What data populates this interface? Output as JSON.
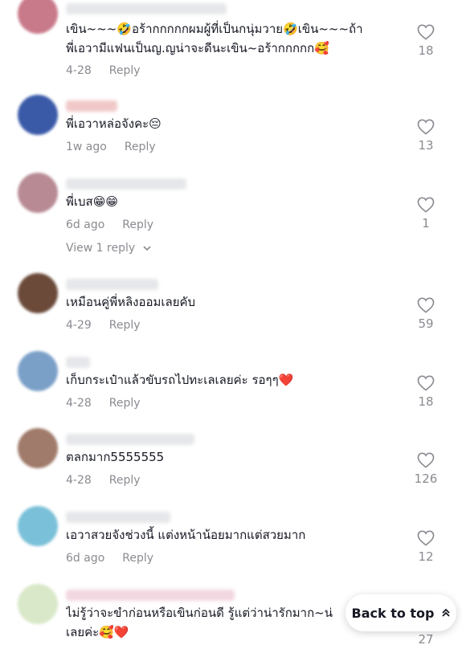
{
  "comments": [
    {
      "text_line1": "เขิน~~~🤣อร้ากกกกกผมผู้ที่เป็นกนุ่มวาย🤣เขิน~~~ถ้า",
      "text_line2": "พี่เอวามีแฟนเป็นญ.ญน่าจะดีนะเขิน~อร้ากกกกก🥰",
      "date": "4-28",
      "reply": "Reply",
      "likes": "18",
      "avatar_color": "#c97a8a"
    },
    {
      "text_line1": "พี่เอวาหล่อจังคะ😔",
      "date": "1w ago",
      "reply": "Reply",
      "likes": "13",
      "avatar_color": "#3a5aa8"
    },
    {
      "text_line1": "พี่เบส😁😁",
      "date": "6d ago",
      "reply": "Reply",
      "likes": "1",
      "view_replies": "View 1 reply",
      "avatar_color": "#b88a94"
    },
    {
      "text_line1": "เหมือนคู่พี่หลิงออมเลยคับ",
      "date": "4-29",
      "reply": "Reply",
      "likes": "59",
      "avatar_color": "#6b4a3a"
    },
    {
      "text_line1": "เก็บกระเป๋าแล้วขับรถไปทะเลเลยค่ะ รอๆๆ❤️",
      "date": "4-28",
      "reply": "Reply",
      "likes": "18",
      "avatar_color": "#7aa0c8"
    },
    {
      "text_line1": "ตลกมาก5555555",
      "date": "4-28",
      "reply": "Reply",
      "likes": "126",
      "avatar_color": "#a07a6a"
    },
    {
      "text_line1": "เอวาสวยจังช่วงนี้ แต่งหน้าน้อยมากแต่สวยมาก",
      "date": "6d ago",
      "reply": "Reply",
      "likes": "12",
      "avatar_color": "#7ac0d8"
    },
    {
      "text_line1": "ไม่รู้ว่าจะขำก่อนหรือเขินก่อนดี รู้แต่ว่าน่ารักมาก~น่",
      "text_line2": "เลยค่ะ🥰❤️",
      "likes": "27",
      "avatar_color": "#d8e8c8"
    }
  ],
  "back_to_top": "Back to top",
  "colors": {
    "text": "#161823",
    "muted": "#8a8b91",
    "heart": "#e8114a"
  }
}
